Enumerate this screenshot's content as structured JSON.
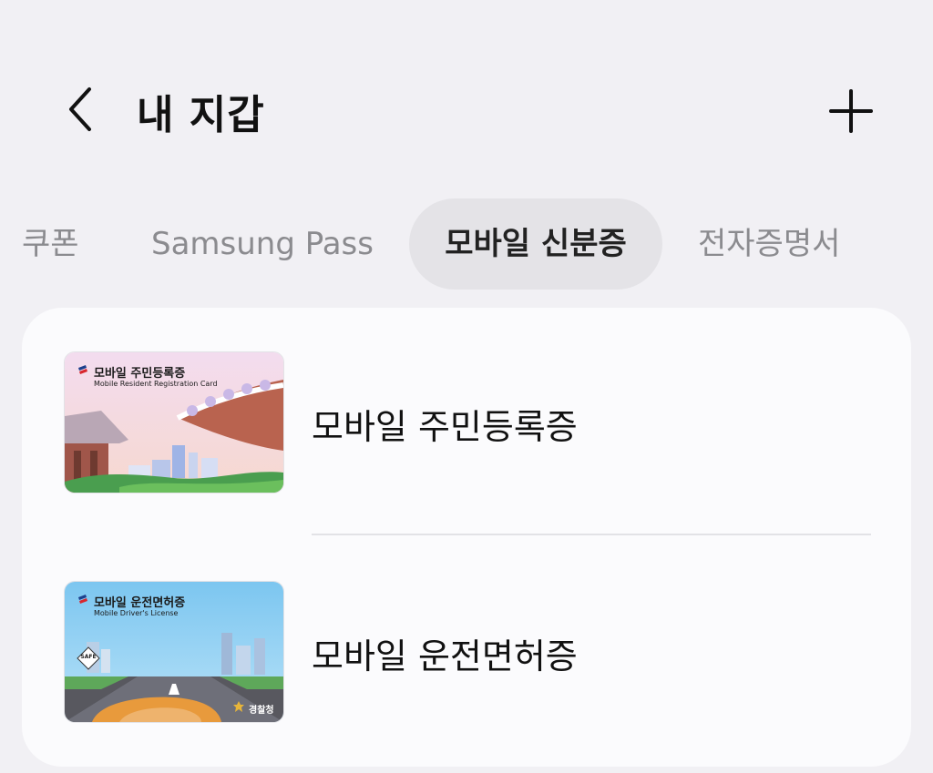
{
  "header": {
    "title": "내 지갑"
  },
  "tabs": [
    {
      "label": "쿠폰"
    },
    {
      "label": "Samsung Pass"
    },
    {
      "label": "모바일 신분증",
      "selected": true
    },
    {
      "label": "전자증명서"
    }
  ],
  "cards": [
    {
      "label": "모바일 주민등록증",
      "thumb_title": "모바일 주민등록증",
      "thumb_subtitle": "Mobile Resident Registration Card"
    },
    {
      "label": "모바일 운전면허증",
      "thumb_title": "모바일 운전면허증",
      "thumb_subtitle": "Mobile Driver's License",
      "thumb_agency": "경찰청",
      "thumb_sign": "SAFE"
    }
  ],
  "colors": {
    "background": "#f1f0f4",
    "panel": "#fbfbfd",
    "selected_tab": "#e4e3e7"
  },
  "icons": {
    "back": "chevron-left-icon",
    "add": "plus-icon"
  }
}
